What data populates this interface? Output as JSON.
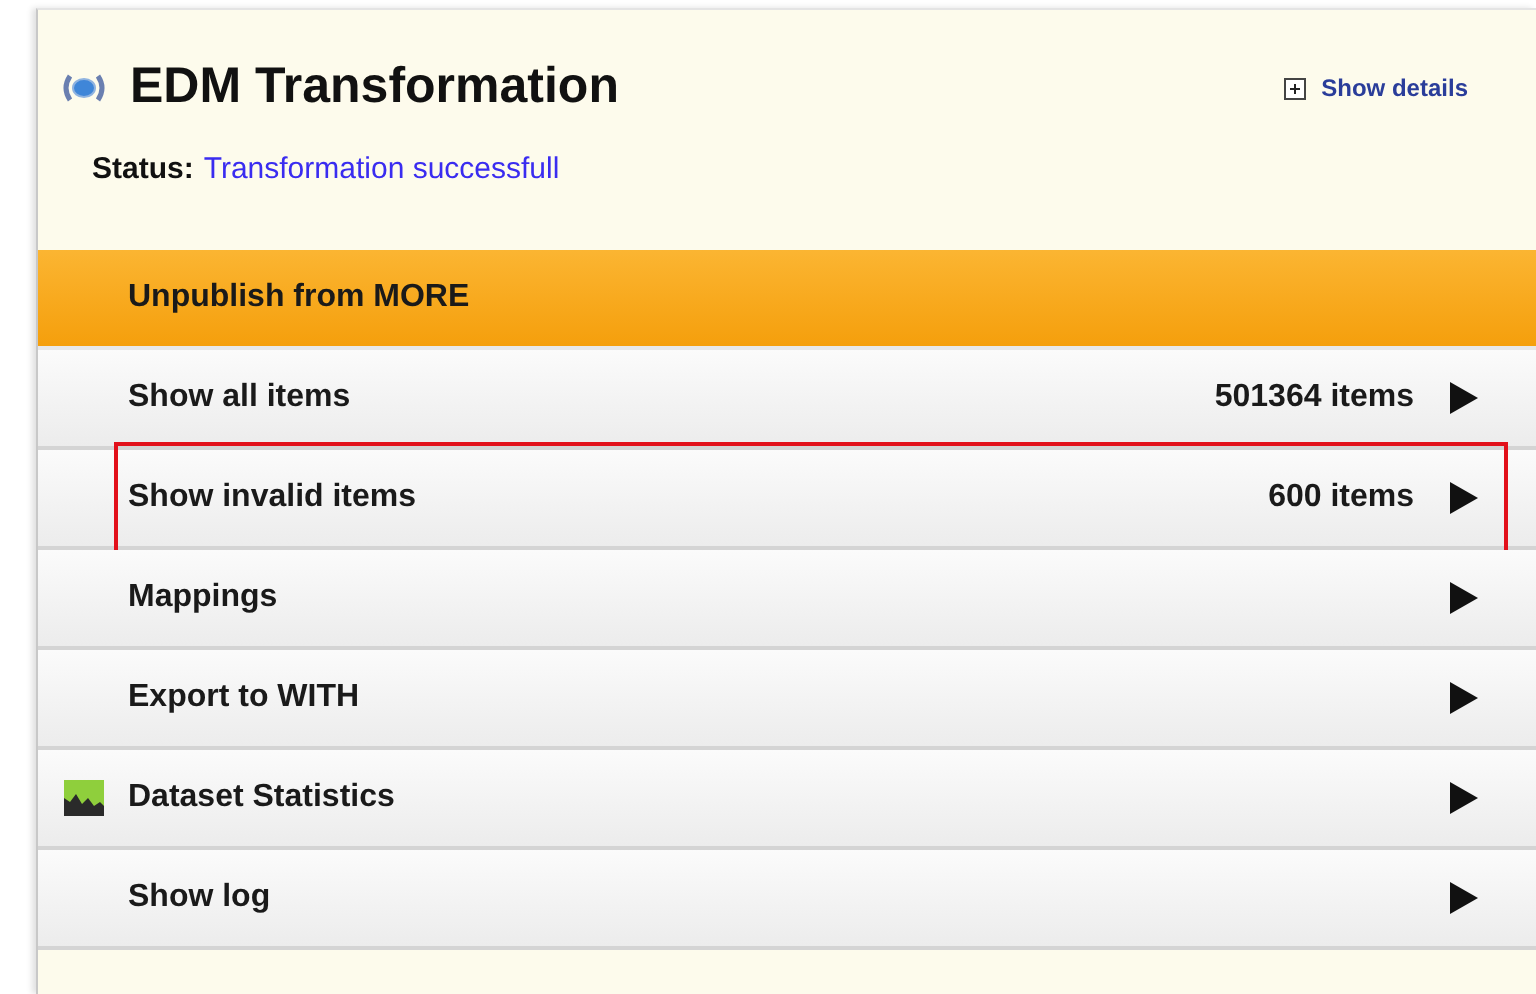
{
  "panel": {
    "title": "EDM Transformation",
    "details_link": "Show details",
    "status_label": "Status:",
    "status_value": "Transformation successfull"
  },
  "items": [
    {
      "label": "Unpublish from MORE",
      "kind": "primary",
      "highlighted": false
    },
    {
      "label": "Show all items",
      "count": "501364 items",
      "kind": "plain",
      "highlighted": false
    },
    {
      "label": "Show invalid items",
      "count": "600 items",
      "kind": "plain",
      "highlighted": true
    },
    {
      "label": "Mappings",
      "kind": "plain",
      "highlighted": false
    },
    {
      "label": "Export to WITH",
      "kind": "plain",
      "highlighted": false
    },
    {
      "label": "Dataset Statistics",
      "kind": "stats",
      "highlighted": false
    },
    {
      "label": "Show log",
      "kind": "plain",
      "highlighted": false
    }
  ]
}
